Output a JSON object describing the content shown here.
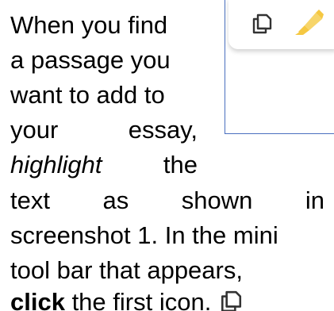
{
  "instructions": {
    "line1": "When you find",
    "line2": "a passage you",
    "line3": "want to add to",
    "line4_word1": "your",
    "line4_word2": "essay,",
    "line5_word1": "highlight",
    "line5_word2": "the",
    "line6_word1": "text",
    "line6_word2": "as",
    "line6_word3": "shown",
    "line6_word4": "in",
    "line7": "screenshot 1. In the mini",
    "line8": "tool bar that appears,",
    "line9_bold": "click",
    "line9_rest": " the first icon."
  },
  "toolbar": {
    "copy_icon": "copy-icon",
    "highlight_icon": "highlighter-icon"
  },
  "colors": {
    "text": "#000000",
    "frame_border": "#4a6fbf",
    "highlighter": "#f5c842"
  }
}
